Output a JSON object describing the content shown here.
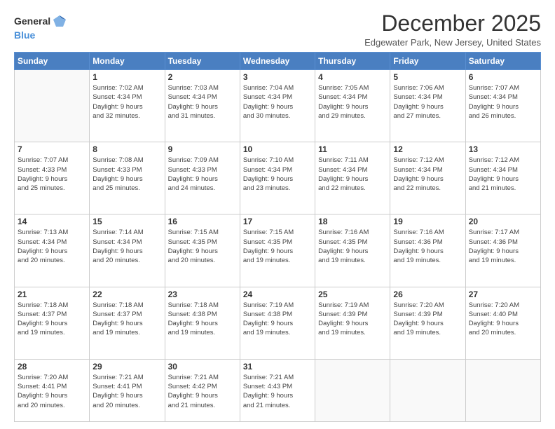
{
  "header": {
    "logo_general": "General",
    "logo_blue": "Blue",
    "month_title": "December 2025",
    "location": "Edgewater Park, New Jersey, United States"
  },
  "days_of_week": [
    "Sunday",
    "Monday",
    "Tuesday",
    "Wednesday",
    "Thursday",
    "Friday",
    "Saturday"
  ],
  "weeks": [
    [
      {
        "day": "",
        "info": ""
      },
      {
        "day": "1",
        "info": "Sunrise: 7:02 AM\nSunset: 4:34 PM\nDaylight: 9 hours\nand 32 minutes."
      },
      {
        "day": "2",
        "info": "Sunrise: 7:03 AM\nSunset: 4:34 PM\nDaylight: 9 hours\nand 31 minutes."
      },
      {
        "day": "3",
        "info": "Sunrise: 7:04 AM\nSunset: 4:34 PM\nDaylight: 9 hours\nand 30 minutes."
      },
      {
        "day": "4",
        "info": "Sunrise: 7:05 AM\nSunset: 4:34 PM\nDaylight: 9 hours\nand 29 minutes."
      },
      {
        "day": "5",
        "info": "Sunrise: 7:06 AM\nSunset: 4:34 PM\nDaylight: 9 hours\nand 27 minutes."
      },
      {
        "day": "6",
        "info": "Sunrise: 7:07 AM\nSunset: 4:34 PM\nDaylight: 9 hours\nand 26 minutes."
      }
    ],
    [
      {
        "day": "7",
        "info": "Sunrise: 7:07 AM\nSunset: 4:33 PM\nDaylight: 9 hours\nand 25 minutes."
      },
      {
        "day": "8",
        "info": "Sunrise: 7:08 AM\nSunset: 4:33 PM\nDaylight: 9 hours\nand 25 minutes."
      },
      {
        "day": "9",
        "info": "Sunrise: 7:09 AM\nSunset: 4:33 PM\nDaylight: 9 hours\nand 24 minutes."
      },
      {
        "day": "10",
        "info": "Sunrise: 7:10 AM\nSunset: 4:34 PM\nDaylight: 9 hours\nand 23 minutes."
      },
      {
        "day": "11",
        "info": "Sunrise: 7:11 AM\nSunset: 4:34 PM\nDaylight: 9 hours\nand 22 minutes."
      },
      {
        "day": "12",
        "info": "Sunrise: 7:12 AM\nSunset: 4:34 PM\nDaylight: 9 hours\nand 22 minutes."
      },
      {
        "day": "13",
        "info": "Sunrise: 7:12 AM\nSunset: 4:34 PM\nDaylight: 9 hours\nand 21 minutes."
      }
    ],
    [
      {
        "day": "14",
        "info": "Sunrise: 7:13 AM\nSunset: 4:34 PM\nDaylight: 9 hours\nand 20 minutes."
      },
      {
        "day": "15",
        "info": "Sunrise: 7:14 AM\nSunset: 4:34 PM\nDaylight: 9 hours\nand 20 minutes."
      },
      {
        "day": "16",
        "info": "Sunrise: 7:15 AM\nSunset: 4:35 PM\nDaylight: 9 hours\nand 20 minutes."
      },
      {
        "day": "17",
        "info": "Sunrise: 7:15 AM\nSunset: 4:35 PM\nDaylight: 9 hours\nand 19 minutes."
      },
      {
        "day": "18",
        "info": "Sunrise: 7:16 AM\nSunset: 4:35 PM\nDaylight: 9 hours\nand 19 minutes."
      },
      {
        "day": "19",
        "info": "Sunrise: 7:16 AM\nSunset: 4:36 PM\nDaylight: 9 hours\nand 19 minutes."
      },
      {
        "day": "20",
        "info": "Sunrise: 7:17 AM\nSunset: 4:36 PM\nDaylight: 9 hours\nand 19 minutes."
      }
    ],
    [
      {
        "day": "21",
        "info": "Sunrise: 7:18 AM\nSunset: 4:37 PM\nDaylight: 9 hours\nand 19 minutes."
      },
      {
        "day": "22",
        "info": "Sunrise: 7:18 AM\nSunset: 4:37 PM\nDaylight: 9 hours\nand 19 minutes."
      },
      {
        "day": "23",
        "info": "Sunrise: 7:18 AM\nSunset: 4:38 PM\nDaylight: 9 hours\nand 19 minutes."
      },
      {
        "day": "24",
        "info": "Sunrise: 7:19 AM\nSunset: 4:38 PM\nDaylight: 9 hours\nand 19 minutes."
      },
      {
        "day": "25",
        "info": "Sunrise: 7:19 AM\nSunset: 4:39 PM\nDaylight: 9 hours\nand 19 minutes."
      },
      {
        "day": "26",
        "info": "Sunrise: 7:20 AM\nSunset: 4:39 PM\nDaylight: 9 hours\nand 19 minutes."
      },
      {
        "day": "27",
        "info": "Sunrise: 7:20 AM\nSunset: 4:40 PM\nDaylight: 9 hours\nand 20 minutes."
      }
    ],
    [
      {
        "day": "28",
        "info": "Sunrise: 7:20 AM\nSunset: 4:41 PM\nDaylight: 9 hours\nand 20 minutes."
      },
      {
        "day": "29",
        "info": "Sunrise: 7:21 AM\nSunset: 4:41 PM\nDaylight: 9 hours\nand 20 minutes."
      },
      {
        "day": "30",
        "info": "Sunrise: 7:21 AM\nSunset: 4:42 PM\nDaylight: 9 hours\nand 21 minutes."
      },
      {
        "day": "31",
        "info": "Sunrise: 7:21 AM\nSunset: 4:43 PM\nDaylight: 9 hours\nand 21 minutes."
      },
      {
        "day": "",
        "info": ""
      },
      {
        "day": "",
        "info": ""
      },
      {
        "day": "",
        "info": ""
      }
    ]
  ]
}
